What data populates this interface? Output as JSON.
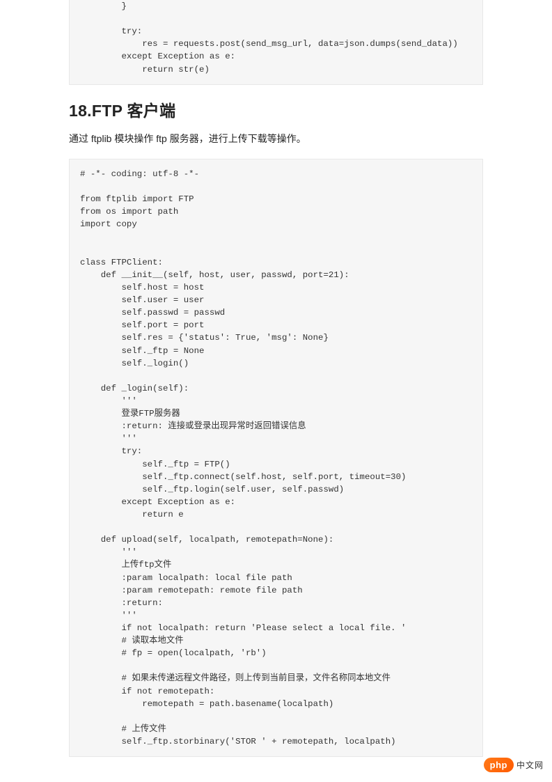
{
  "codeblock1": "        }\n\n        try:\n            res = requests.post(send_msg_url, data=json.dumps(send_data))\n        except Exception as e:\n            return str(e)",
  "heading": "18.FTP 客户端",
  "description": "通过 ftplib 模块操作 ftp 服务器，进行上传下载等操作。",
  "codeblock2": "# -*- coding: utf-8 -*-\n\nfrom ftplib import FTP\nfrom os import path\nimport copy\n\n\nclass FTPClient:\n    def __init__(self, host, user, passwd, port=21):\n        self.host = host\n        self.user = user\n        self.passwd = passwd\n        self.port = port\n        self.res = {'status': True, 'msg': None}\n        self._ftp = None\n        self._login()\n\n    def _login(self):\n        '''\n        登录FTP服务器\n        :return: 连接或登录出现异常时返回错误信息\n        '''\n        try:\n            self._ftp = FTP()\n            self._ftp.connect(self.host, self.port, timeout=30)\n            self._ftp.login(self.user, self.passwd)\n        except Exception as e:\n            return e\n\n    def upload(self, localpath, remotepath=None):\n        '''\n        上传ftp文件\n        :param localpath: local file path\n        :param remotepath: remote file path\n        :return:\n        '''\n        if not localpath: return 'Please select a local file. '\n        # 读取本地文件\n        # fp = open(localpath, 'rb')\n\n        # 如果未传递远程文件路径，则上传到当前目录，文件名称同本地文件\n        if not remotepath:\n            remotepath = path.basename(localpath)\n\n        # 上传文件\n        self._ftp.storbinary('STOR ' + remotepath, localpath)",
  "badge": {
    "pill": "php",
    "text": "中文网"
  }
}
